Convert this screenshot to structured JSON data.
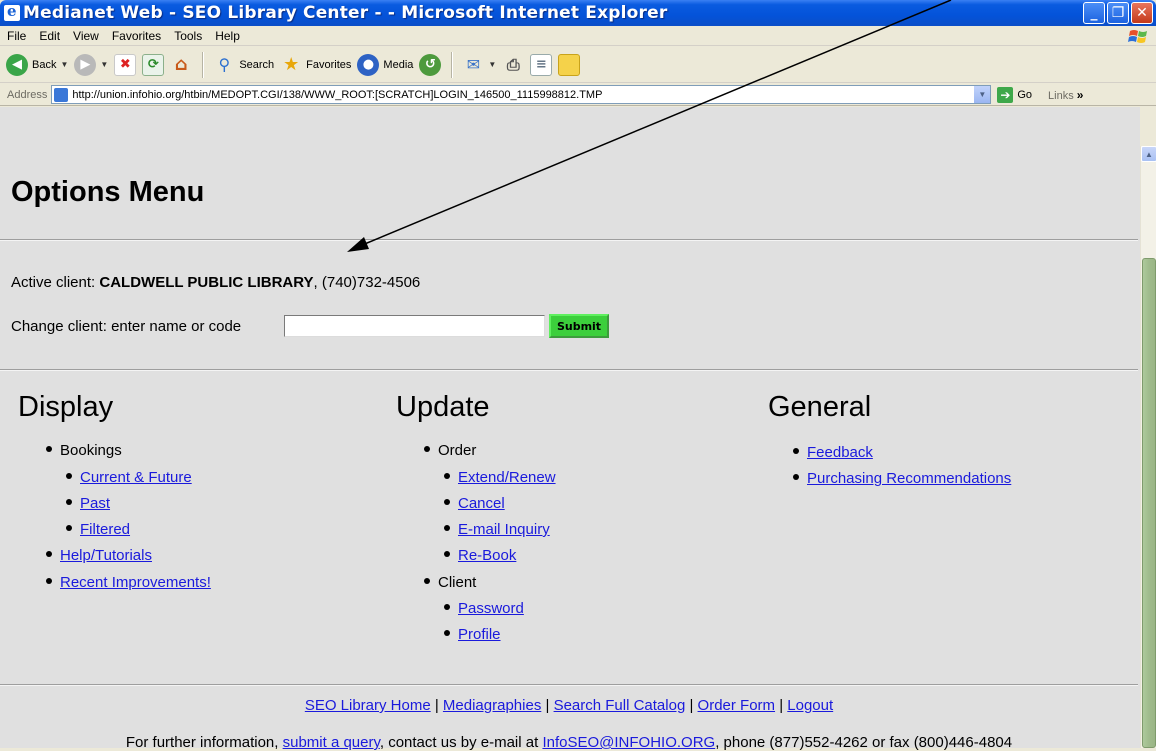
{
  "window": {
    "title": "Medianet Web - SEO Library Center - - Microsoft Internet Explorer",
    "buttons": {
      "minimize": "_",
      "maximize": "❐",
      "close": "✕"
    }
  },
  "menubar": [
    "File",
    "Edit",
    "View",
    "Favorites",
    "Tools",
    "Help"
  ],
  "toolbar": {
    "back": "Back",
    "search": "Search",
    "favorites": "Favorites",
    "media": "Media"
  },
  "addressbar": {
    "label": "Address",
    "url": "http://union.infohio.org/htbin/MEDOPT.CGI/138/WWW_ROOT:[SCRATCH]LOGIN_146500_1115998812.TMP",
    "go": "Go",
    "links": "Links"
  },
  "page": {
    "title": "Options Menu",
    "active_client_label": "Active client:",
    "active_client_name": "CALDWELL PUBLIC LIBRARY",
    "active_client_phone": ", (740)732-4506",
    "change_client_label": "Change client: enter name or code",
    "change_client_value": "",
    "submit": "Submit",
    "columns": {
      "display": {
        "heading": "Display",
        "bookings": "Bookings",
        "current_future": "Current & Future",
        "past": "Past",
        "filtered": "Filtered",
        "help_tutorials": "Help/Tutorials",
        "recent_improvements": "Recent Improvements!"
      },
      "update": {
        "heading": "Update",
        "order": "Order",
        "extend_renew": "Extend/Renew",
        "cancel": "Cancel",
        "email_inquiry": "E-mail Inquiry",
        "rebook": "Re-Book",
        "client": "Client",
        "password": "Password",
        "profile": "Profile"
      },
      "general": {
        "heading": "General",
        "feedback": "Feedback",
        "purchasing_recommendations": "Purchasing Recommendations"
      }
    },
    "footer_links": {
      "home": "SEO Library Home",
      "mediagraphies": "Mediagraphies",
      "search_catalog": "Search Full Catalog",
      "order_form": "Order Form",
      "logout": "Logout",
      "separator": " | "
    },
    "footer_info": {
      "prefix": "For further information,",
      "submit_query": "submit a query",
      "middle": ", contact us by e-mail at",
      "email": "InfoSEO@INFOHIO.ORG",
      "suffix": ", phone (877)552-4262 or fax (800)446-4804"
    }
  },
  "colors": {
    "titlebar": "#0453d9",
    "page_bg": "#e0e0e0",
    "link": "#1a1adc",
    "submit_bg": "#3ccf3c"
  }
}
